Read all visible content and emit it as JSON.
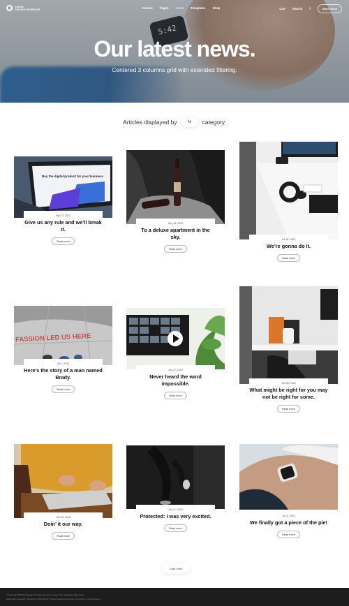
{
  "nav": {
    "logo_line1": "Vestige",
    "logo_line2": "THE MULTIPURPOSE",
    "menu": [
      "Demos",
      "Pages",
      "Icons",
      "Templates",
      "Shop"
    ],
    "cart": "Cart",
    "search": "Search",
    "icon": "f",
    "cta": "Start Demo"
  },
  "hero": {
    "watch_time": "5:42",
    "title": "Our latest news.",
    "subtitle": "Centered 3 columns grid with extended filtering."
  },
  "filter": {
    "before": "Articles displayed by",
    "chip": "All",
    "after": "category."
  },
  "posts": [
    {
      "date": "Sep 23, 2022",
      "title": "Give us any rule and we’ll break it.",
      "button": "Read more"
    },
    {
      "date": "Aug 16, 2022",
      "title": "To a deluxe apartment in the sky.",
      "button": "Read more"
    },
    {
      "date": "Jul 16, 2022",
      "title": "We’re gonna do it.",
      "button": "Read more"
    },
    {
      "date": "Jul 1, 2022",
      "title": "Here’s the story of a man named Brady.",
      "button": "Read more"
    },
    {
      "date": "Jun 27, 2022",
      "title": "Never heard the word impossible.",
      "button": "Read more"
    },
    {
      "date": "Jun 26, 2022",
      "title": "What might be right for you may not be right for some.",
      "button": "Read more"
    },
    {
      "date": "Jun 24, 2022",
      "title": "Doin’ it our way.",
      "button": "Read more"
    },
    {
      "date": "Jun 11, 2022",
      "title": "Protected: I was very excited.",
      "button": "Read more"
    },
    {
      "date": "Jun 8, 2022",
      "title": "We finally got a piece of the pie!",
      "button": "Read more"
    }
  ],
  "image_text": {
    "laptop_screen": "Buy the digital product for your business",
    "wall_text": "FASSION LED US HERE"
  },
  "load_more": "Load more",
  "footer": {
    "line1": "© Copyright 2022 by Vestige. All rights reserved. Images from Unsplash and Pexels.",
    "line2": "Made with a passion. Powered by WordPress. Theme designed with care for creators and businesses."
  }
}
